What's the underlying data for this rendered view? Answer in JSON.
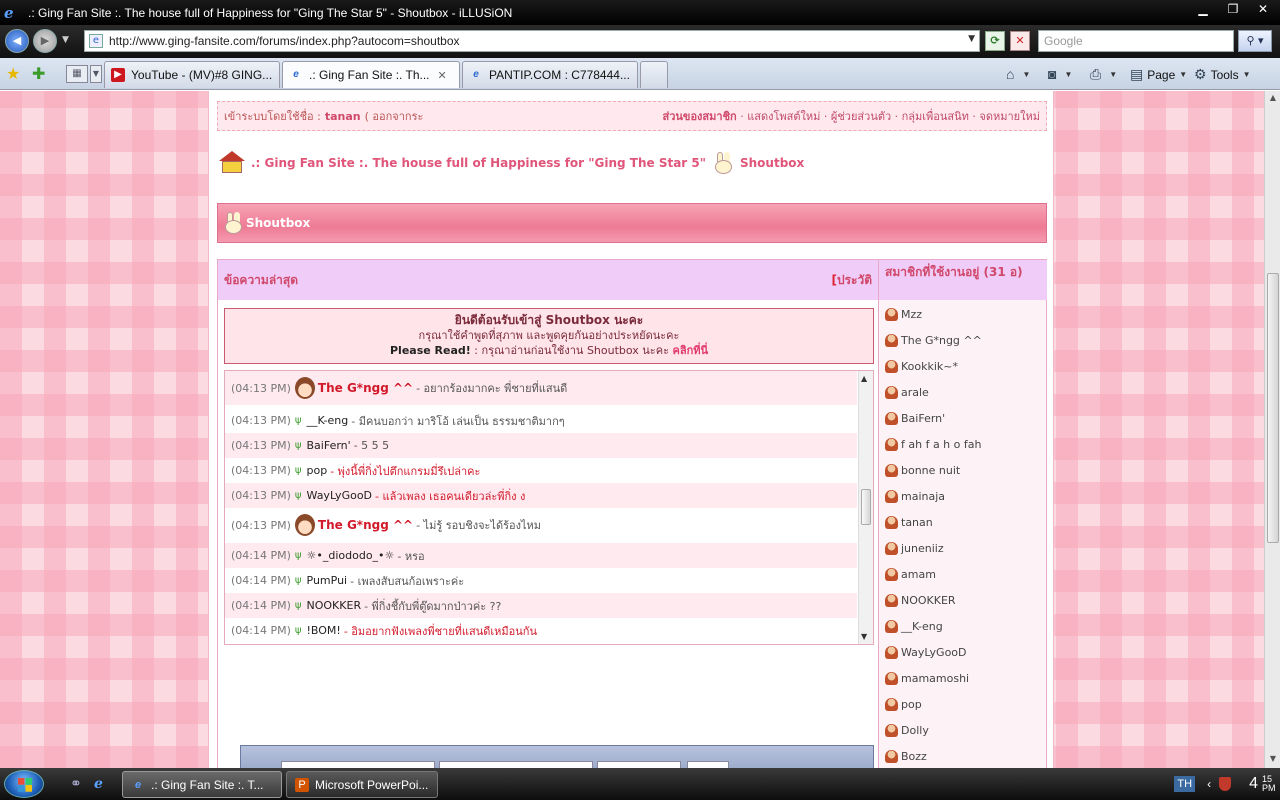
{
  "window": {
    "title": ".: Ging Fan Site :. The house full of Happiness for \"Ging The Star 5\" - Shoutbox - iLLUSiON",
    "minimize": "▁",
    "maximize": "❐",
    "close": "✕"
  },
  "browser": {
    "url": "http://www.ging-fansite.com/forums/index.php?autocom=shoutbox",
    "search_placeholder": "Google",
    "tabs": [
      {
        "label": "YouTube - (MV)#8 GING...",
        "icon": "youtube-icon"
      },
      {
        "label": ".: Ging Fan Site :. Th...",
        "icon": "ie-page-icon"
      },
      {
        "label": "PANTIP.COM : C778444...",
        "icon": "ie-page-icon"
      }
    ],
    "commands": {
      "page": "Page",
      "tools": "Tools"
    }
  },
  "forum": {
    "login_prefix": "เข้าระบบโดยใช้ชื่อ :",
    "login_user": "tanan",
    "logout": "( ออกจากระ",
    "member_area": "ส่วนของสมาชิก",
    "member_links": "· แสดงโพสต์ใหม่ · ผู้ช่วยส่วนตัว · กลุ่มเพื่อนสนิท · จดหมายใหม่",
    "breadcrumb_site": ".: Ging Fan Site :. The house full of Happiness for \"Ging The Star 5\"",
    "breadcrumb_page": "Shoutbox",
    "shoutbox_title": "Shoutbox"
  },
  "shoutbox": {
    "latest_heading": "ข้อความล่าสุด",
    "history_bracket": "[",
    "history_label": "ประวัติ",
    "online_heading": "สมาชิกที่ใช้งานอยู่ (31 อ)",
    "welcome_line1": "ยินดีต้อนรับเข้าสู่ Shoutbox นะคะ",
    "welcome_line2": "กรุณาใช้คำพูดที่สุภาพ และพูดคุยกันอย่างประหยัดนะคะ",
    "welcome_line3_bold": "Please Read!",
    "welcome_line3_text": ": กรุณาอ่านก่อนใช้งาน Shoutbox นะคะ",
    "welcome_link": "คลิกที่นี่",
    "messages": [
      {
        "time": "(04:13 PM)",
        "user": "The G*ngg ^^",
        "admin": true,
        "text": "- อยากร้องมากคะ พี่ชายที่แสนดี",
        "red": false
      },
      {
        "time": "(04:13 PM)",
        "user": "__K-eng",
        "admin": false,
        "text": "- มีคนบอกว่า มาริโอ้ เล่นเป็น ธรรมชาติมากๆ",
        "red": false
      },
      {
        "time": "(04:13 PM)",
        "user": "BaiFern'",
        "admin": false,
        "text": "- 5 5 5",
        "red": false
      },
      {
        "time": "(04:13 PM)",
        "user": "pop",
        "admin": false,
        "text": "- พุ่งนี้พี่กิ่งไปตึกแกรมมี่รึเปล่าคะ",
        "red": true
      },
      {
        "time": "(04:13 PM)",
        "user": "WayLyGooD",
        "admin": false,
        "text": "- แล้วเพลง เธอคนเดียวล่ะพี่กิ่ง ง",
        "red": true
      },
      {
        "time": "(04:13 PM)",
        "user": "The G*ngg ^^",
        "admin": true,
        "text": "- ไม่รู้ รอบชิงจะได้ร้องไหม",
        "red": false
      },
      {
        "time": "(04:14 PM)",
        "user": "☼•_diododo_•☼",
        "admin": false,
        "text": "- หรอ",
        "red": false
      },
      {
        "time": "(04:14 PM)",
        "user": "PumPui",
        "admin": false,
        "text": "- เพลงสับสนก้อเพราะค่ะ",
        "red": false
      },
      {
        "time": "(04:14 PM)",
        "user": "NOOKKER",
        "admin": false,
        "text": "- พี่กิ่งชี้กับพี่ตู๊ดมากป่าวค่ะ ??",
        "red": false
      },
      {
        "time": "(04:14 PM)",
        "user": "!BOM!",
        "admin": false,
        "text": "- อิมอยากฟังเพลงพี่ชายที่แสนดีเหมือนกัน",
        "red": true
      }
    ],
    "members": [
      "Mzz",
      "The G*ngg ^^",
      "Kookkik~*",
      "arale",
      "BaiFern'",
      "f ah f a h o fah",
      "bonne nuit",
      "mainaja",
      "tanan",
      "juneniiz",
      "amam",
      "NOOKKER",
      "__K-eng",
      "WayLyGooD",
      "mamamoshi",
      "pop",
      "Dolly",
      "Bozz"
    ]
  },
  "taskbar": {
    "tasks": [
      {
        "label": ".: Ging Fan Site :. T...",
        "icon": "ie-icon"
      },
      {
        "label": "Microsoft PowerPoi...",
        "icon": "powerpoint-icon"
      }
    ],
    "language": "TH",
    "time": "4",
    "time_small": "15 PM"
  }
}
